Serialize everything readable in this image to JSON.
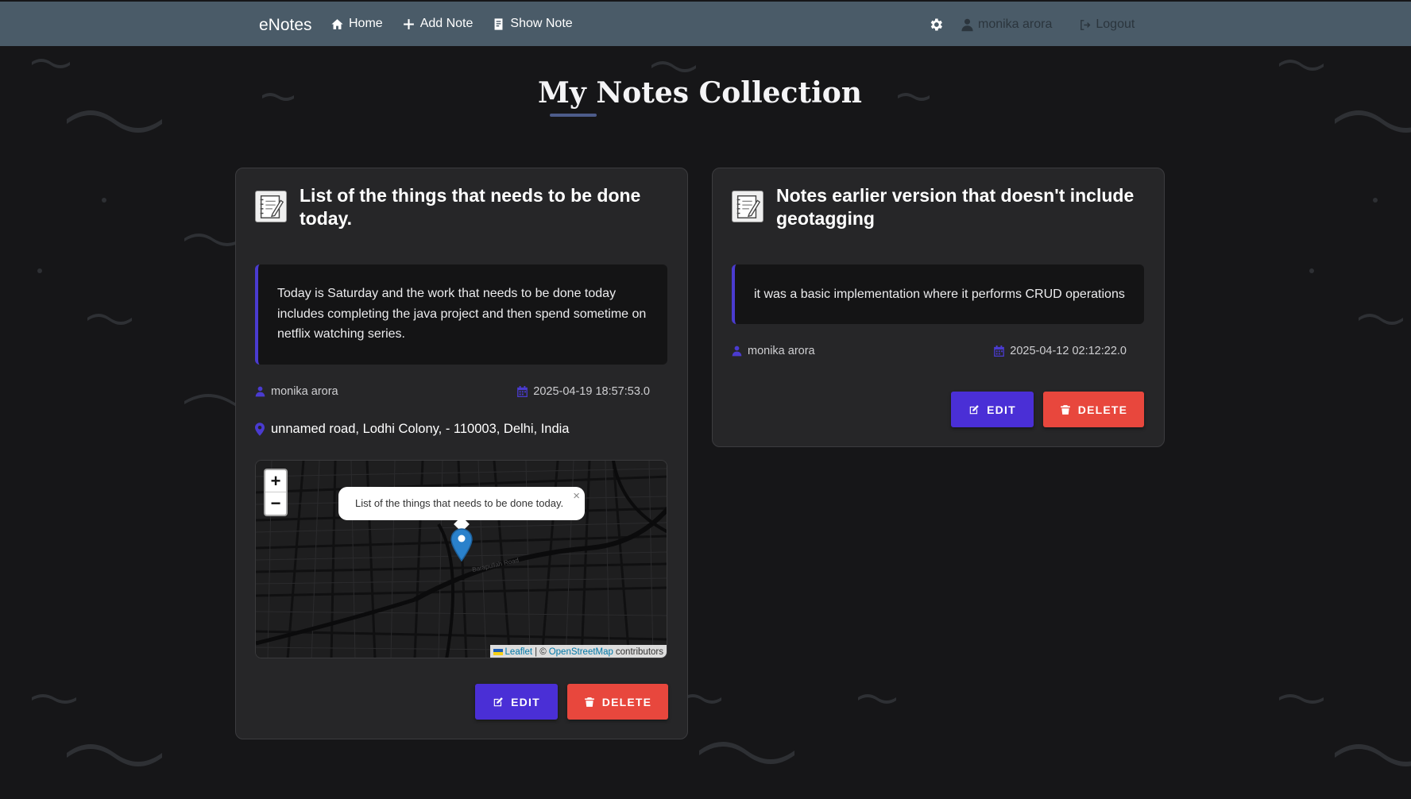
{
  "navbar": {
    "brand": "eNotes",
    "links": [
      {
        "label": "Home",
        "icon": "home-icon"
      },
      {
        "label": "Add Note",
        "icon": "plus-icon"
      },
      {
        "label": "Show Note",
        "icon": "note-icon"
      }
    ],
    "username": "monika arora",
    "logout_label": "Logout"
  },
  "page": {
    "title": "My Notes Collection"
  },
  "notes": [
    {
      "title": "List of the things that needs to be done today.",
      "content": "Today is Saturday and the work that needs to be done today includes completing the java project and then spend sometime on netflix watching series.",
      "author": "monika arora",
      "date": "2025-04-19 18:57:53.0",
      "location": "unnamed road, Lodhi Colony, - 110003, Delhi, India",
      "map": {
        "popup_text": "List of the things that needs to be done today.",
        "popup_close": "×",
        "zoom_in": "+",
        "zoom_out": "−",
        "road_label": "Barapullah Road",
        "attribution_leaflet": "Leaflet",
        "attribution_sep": "| ©",
        "attribution_osm": "OpenStreetMap",
        "attribution_suffix": "contributors"
      },
      "edit_label": "EDIT",
      "delete_label": "DELETE"
    },
    {
      "title": "Notes earlier version that doesn't include geotagging",
      "content": "it was a basic implementation where it performs CRUD operations",
      "author": "monika arora",
      "date": "2025-04-12 02:12:22.0",
      "edit_label": "EDIT",
      "delete_label": "DELETE"
    }
  ],
  "colors": {
    "background": "#161618",
    "navbar": "#4a5b68",
    "card": "#262628",
    "accent": "#4a3bd0",
    "edit": "#4a2fd6",
    "delete": "#e8473d",
    "marker": "#2a81cb"
  }
}
